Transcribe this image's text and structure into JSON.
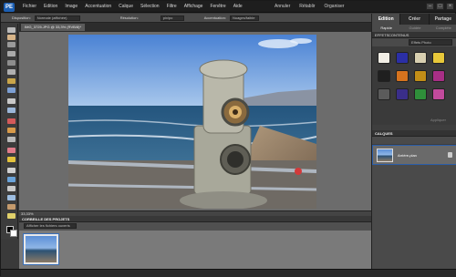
{
  "menubar": {
    "logo": "PE",
    "menus": [
      "Fichier",
      "Edition",
      "Image",
      "Accentuation",
      "Calque",
      "Sélection",
      "Filtre",
      "Affichage",
      "Fenêtre",
      "Aide"
    ],
    "right_items": [
      "Annuler",
      "Rétablir",
      "Organiser"
    ]
  },
  "options_bar": {
    "label1": "Disposition:",
    "field1": "Normale (affichée)",
    "label2": "Résolution:",
    "field2": "pix/po",
    "label3": "Accentuation:",
    "field3": "Nuages/faible"
  },
  "document": {
    "tab_title": "IMG_3725.JPG @ 33,3% (RVB/8)*",
    "zoom_status": "33,33%"
  },
  "project_bin": {
    "header": "CORBEILLE DES PROJETS",
    "selector": "Afficher les fichiers ouverts"
  },
  "right_panel": {
    "tabs": [
      "Edition",
      "Créer",
      "Partage"
    ],
    "subtabs": [
      "Rapide",
      "Guidée",
      "Complète"
    ],
    "effects_header": "EFFETS",
    "content_header": "CONTENUS",
    "effects_selector": "Effets Photo",
    "apply_label": "Appliquer",
    "layers_header": "CALQUES",
    "layer_name": "Arrière-plan"
  },
  "colors": {
    "accent": "#2a5da8",
    "panel_bg": "#3e3e3e",
    "menu_bg": "#1e1e1e"
  }
}
